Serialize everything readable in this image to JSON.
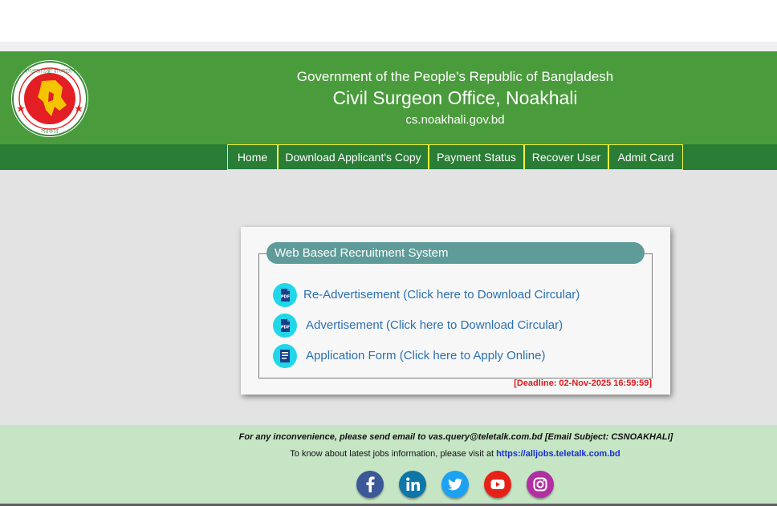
{
  "header": {
    "government": "Government of the People's Republic of Bangladesh",
    "office": "Civil Surgeon Office, Noakhali",
    "domain": "cs.noakhali.gov.bd",
    "logo_text_top": "গণপ্রজাতন্ত্রী বাংলাদেশ",
    "logo_text_bottom": "সরকার",
    "bg_color": "#4a9b3c",
    "nav_color": "#2a7d34",
    "nav_border_color": "#f2f238"
  },
  "nav": {
    "items": [
      {
        "label": "Home"
      },
      {
        "label": "Download Applicant's Copy"
      },
      {
        "label": "Payment Status"
      },
      {
        "label": "Recover User"
      },
      {
        "label": "Admit Card"
      }
    ]
  },
  "main": {
    "legend": "Web Based Recruitment System",
    "links": [
      {
        "label": "Re-Advertisement (Click here to Download Circular)",
        "icon": "pdf-icon"
      },
      {
        "label": "Advertisement (Click here to Download Circular)",
        "icon": "pdf-icon"
      },
      {
        "label": "Application Form (Click here to Apply Online)",
        "icon": "form-icon"
      }
    ],
    "deadline": "[Deadline: 02-Nov-2025 16:59:59]",
    "link_color": "#2a70b0",
    "deadline_color": "#e0181b",
    "legend_color": "#5e9b99"
  },
  "footer": {
    "contact": "For any inconvenience, please send email to vas.query@teletalk.com.bd [Email Subject: CSNOAKHALI]",
    "jobs_prefix": "To know about latest jobs information, please visit at ",
    "jobs_link": "https://alljobs.teletalk.com.bd",
    "social": [
      {
        "icon": "facebook-icon",
        "color": "#3b5998"
      },
      {
        "icon": "linkedin-icon",
        "color": "#0e76a8"
      },
      {
        "icon": "twitter-icon",
        "color": "#1da1f2"
      },
      {
        "icon": "youtube-icon",
        "color": "#e62117"
      },
      {
        "icon": "instagram-icon",
        "color": "#b12fa3"
      }
    ],
    "bg_color": "#c6e5c4"
  }
}
